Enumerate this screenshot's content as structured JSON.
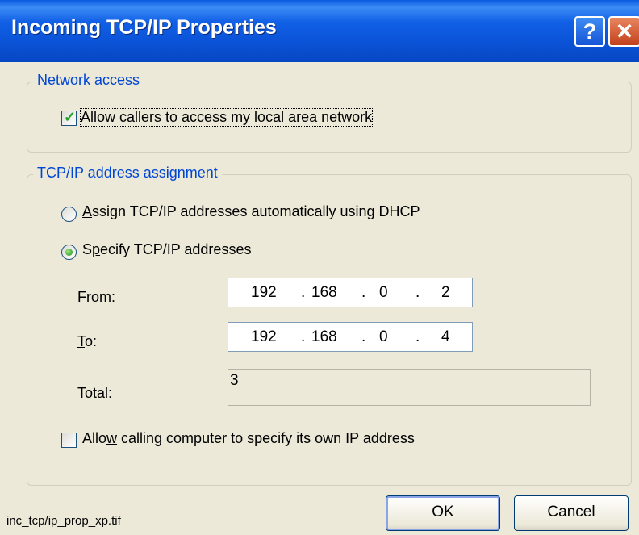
{
  "window": {
    "title": "Incoming TCP/IP Properties",
    "help_glyph": "?",
    "close_glyph": "✕"
  },
  "network_access": {
    "group_label": "Network access",
    "allow_lan": {
      "label": "Allow callers to access my local area network",
      "checked": true
    }
  },
  "tcpip": {
    "group_label": "TCP/IP address assignment",
    "dhcp_option": {
      "label_pre": "",
      "mnemonic": "A",
      "label_post": "ssign TCP/IP addresses automatically using DHCP",
      "selected": false
    },
    "specify_option": {
      "label_pre": "S",
      "mnemonic": "p",
      "label_post": "ecify TCP/IP addresses",
      "selected": true
    },
    "from": {
      "mnemonic": "F",
      "label_rest": "rom:",
      "octets": [
        "192",
        "168",
        "0",
        "2"
      ]
    },
    "to": {
      "mnemonic": "T",
      "label_rest": "o:",
      "octets": [
        "192",
        "168",
        "0",
        "4"
      ]
    },
    "ip_separator": ".",
    "total": {
      "label": "Total:",
      "value": "3"
    },
    "allow_own_ip": {
      "label_pre": "Allo",
      "mnemonic": "w",
      "label_post": " calling computer to specify its own IP address",
      "checked": false
    }
  },
  "buttons": {
    "ok": "OK",
    "cancel": "Cancel"
  },
  "caption": "inc_tcp/ip_prop_xp.tif"
}
